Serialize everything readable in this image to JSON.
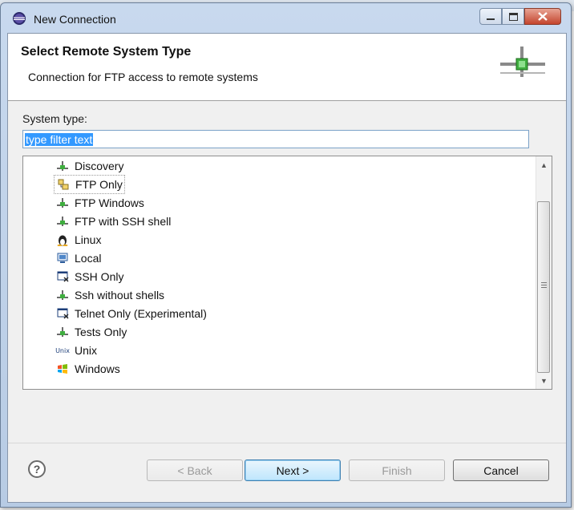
{
  "window": {
    "title": "New Connection",
    "controls": [
      "minimize-icon",
      "maximize-icon",
      "close-icon"
    ]
  },
  "header": {
    "title": "Select Remote System Type",
    "description": "Connection for FTP access to remote systems"
  },
  "form": {
    "system_type_label": "System type:",
    "filter_value": "type filter text"
  },
  "system_types": [
    {
      "label": "Discovery",
      "icon": "network-icon"
    },
    {
      "label": "FTP Only",
      "icon": "ftp-icon",
      "selected": true
    },
    {
      "label": "FTP Windows",
      "icon": "network-icon"
    },
    {
      "label": "FTP with SSH shell",
      "icon": "network-icon"
    },
    {
      "label": "Linux",
      "icon": "linux-penguin-icon"
    },
    {
      "label": "Local",
      "icon": "monitor-icon"
    },
    {
      "label": "SSH Only",
      "icon": "terminal-icon"
    },
    {
      "label": "Ssh without shells",
      "icon": "network-icon"
    },
    {
      "label": "Telnet Only (Experimental)",
      "icon": "terminal-icon"
    },
    {
      "label": "Tests Only",
      "icon": "network-icon"
    },
    {
      "label": "Unix",
      "icon": "unix-icon"
    },
    {
      "label": "Windows",
      "icon": "windows-flag-icon"
    }
  ],
  "unix_icon_text": "Unix",
  "buttons": {
    "help": "?",
    "back": "< Back",
    "next": "Next >",
    "finish": "Finish",
    "cancel": "Cancel"
  },
  "colors": {
    "selection": "#3399ff",
    "default_button": "#3c7fb1"
  }
}
